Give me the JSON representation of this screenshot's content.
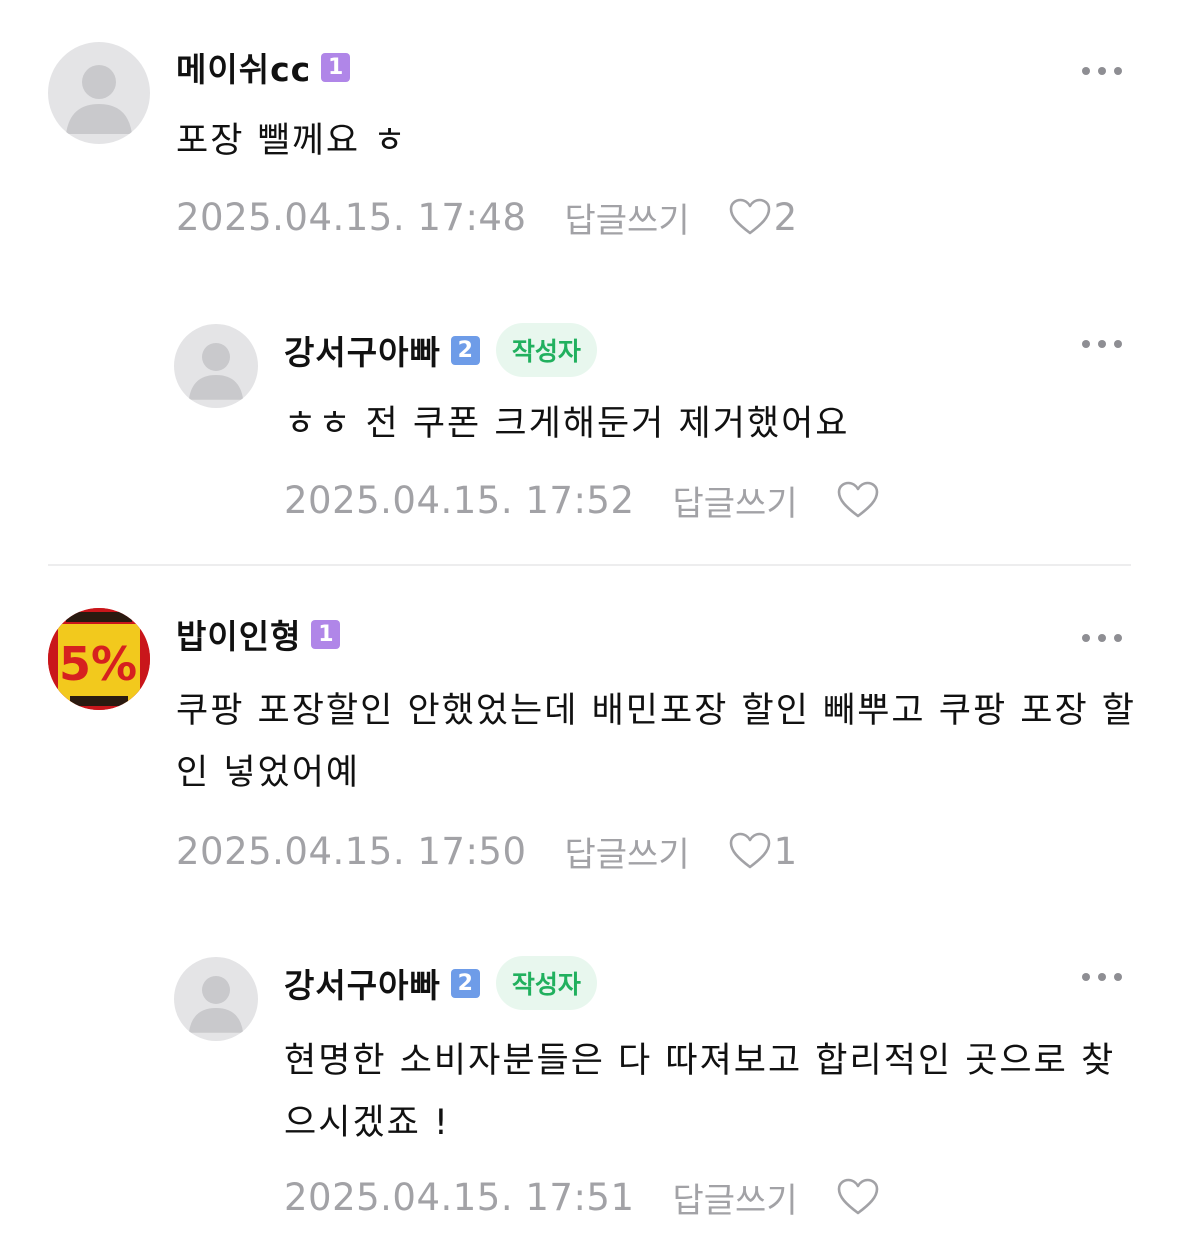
{
  "comments": [
    {
      "nickname": "메이쉬cc",
      "level": "1",
      "text": "포장 뺄께요 ㅎ",
      "date": "2025.04.15. 17:48",
      "reply_label": "답글쓰기",
      "like_count": "2"
    },
    {
      "nickname": "강서구아빠",
      "level": "2",
      "author_badge": "작성자",
      "text": "ㅎㅎ 전 쿠폰 크게해둔거 제거했어요",
      "date": "2025.04.15. 17:52",
      "reply_label": "답글쓰기",
      "like_count": ""
    },
    {
      "nickname": "밥이인형",
      "level": "1",
      "avatar_text": "5%",
      "text": "쿠팡 포장할인 안했었는데 배민포장 할인 빼뿌고 쿠팡 포장 할인 넣었어예",
      "date": "2025.04.15. 17:50",
      "reply_label": "답글쓰기",
      "like_count": "1"
    },
    {
      "nickname": "강서구아빠",
      "level": "2",
      "author_badge": "작성자",
      "text": "현명한 소비자분들은 다 따져보고 합리적인 곳으로 찾으시겠죠 !",
      "date": "2025.04.15. 17:51",
      "reply_label": "답글쓰기",
      "like_count": ""
    }
  ],
  "colors": {
    "meta_gray": "#a2a2a6",
    "author_badge_bg": "#e8f7ee",
    "author_badge_text": "#21b05e",
    "level1": "#b086e8",
    "level2": "#6e9ce8"
  }
}
